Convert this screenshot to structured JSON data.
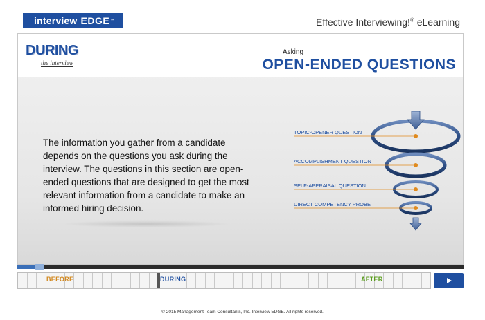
{
  "brand": {
    "part1": "interview",
    "part2": "EDGE",
    "tm": "™"
  },
  "product": {
    "name": "Effective Interviewing!",
    "sup": "®",
    "suffix": " eLearning"
  },
  "section": {
    "title": "DURING",
    "subtitle": "the interview"
  },
  "topic": {
    "kicker": "Asking",
    "title": "OPEN-ENDED QUESTIONS"
  },
  "body": "The information you gather from a candidate depends on the questions you ask during the interview. The questions in this section are open-ended questions that are designed to get the most relevant information from a candidate to make an informed hiring decision.",
  "diagram": {
    "labels": [
      "TOPIC-OPENER QUESTION",
      "ACCOMPLISHMENT QUESTION",
      "SELF-APPRAISAL QUESTION",
      "DIRECT COMPETENCY PROBE"
    ],
    "accent": "#e08a1e",
    "ring_color": "#2e4f86"
  },
  "progress": {
    "fraction": 0.05
  },
  "nav": {
    "before": "BEFORE",
    "during": "DURING",
    "after": "AFTER",
    "next_icon": "play-triangle-icon"
  },
  "footer": "© 2015 Management Team Consultants, Inc. Interview EDGE. All rights reserved.",
  "colors": {
    "brand_blue": "#1f4fa0",
    "before": "#d2881e",
    "after": "#5a9c1e"
  }
}
